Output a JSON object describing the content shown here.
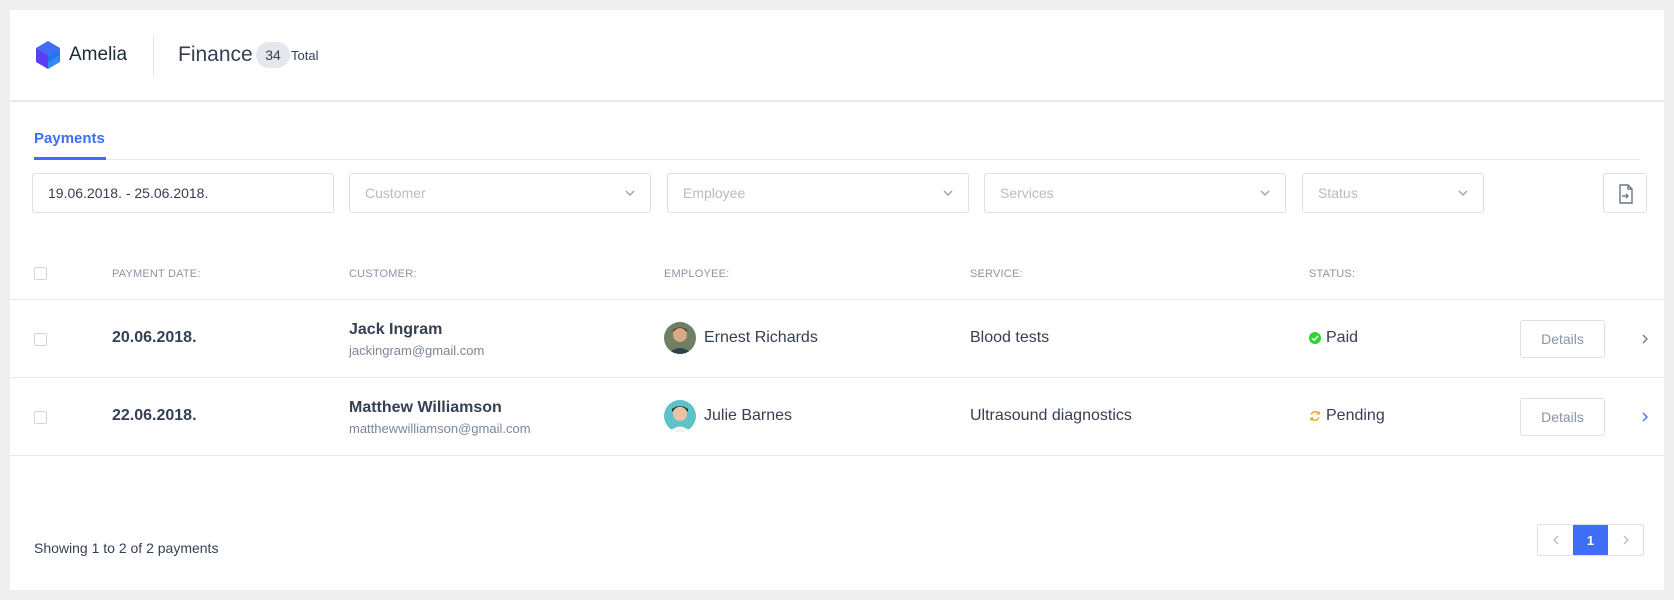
{
  "header": {
    "brand": "Amelia",
    "title": "Finance",
    "count": "34",
    "count_label": "Total"
  },
  "tabs": [
    {
      "label": "Payments",
      "active": true
    }
  ],
  "filters": {
    "date_range": "19.06.2018. - 25.06.2018.",
    "customer_placeholder": "Customer",
    "employee_placeholder": "Employee",
    "services_placeholder": "Services",
    "status_placeholder": "Status"
  },
  "table": {
    "headers": {
      "payment_date": "PAYMENT DATE:",
      "customer": "CUSTOMER:",
      "employee": "EMPLOYEE:",
      "service": "SERVICE:",
      "status": "STATUS:"
    },
    "rows": [
      {
        "date": "20.06.2018.",
        "customer_name": "Jack Ingram",
        "customer_email": "jackingram@gmail.com",
        "employee": "Ernest Richards",
        "service": "Blood tests",
        "status": "Paid",
        "status_color": "#2ed42e",
        "action": "Details"
      },
      {
        "date": "22.06.2018.",
        "customer_name": "Matthew Williamson",
        "customer_email": "matthewwilliamson@gmail.com",
        "employee": "Julie Barnes",
        "service": "Ultrasound diagnostics",
        "status": "Pending",
        "status_color": "#f5a623",
        "action": "Details"
      }
    ]
  },
  "footer": {
    "showing": "Showing 1 to 2 of 2 payments",
    "current_page": "1"
  },
  "colors": {
    "accent": "#3d6ef5",
    "text": "#354052",
    "muted": "#8a95a5"
  },
  "icons": {
    "logo": "amelia-logo-icon",
    "export": "export-file-icon",
    "dropdown": "chevron-down-icon",
    "row_expand": "chevron-right-icon",
    "paid": "check-circle-icon",
    "pending": "refresh-icon"
  }
}
